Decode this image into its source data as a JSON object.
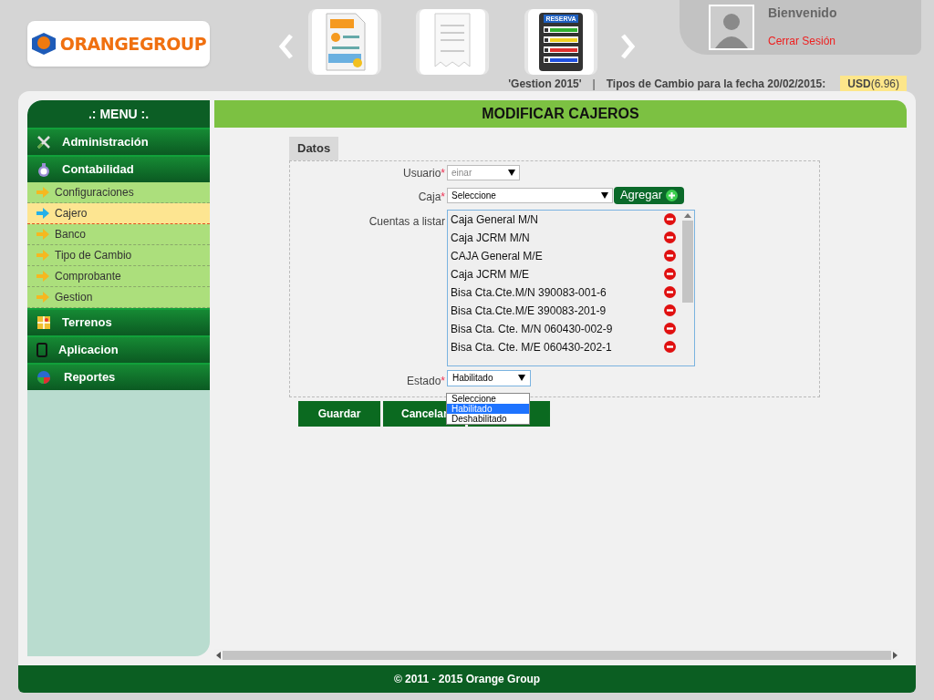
{
  "header": {
    "logo": "ORANGEGROUP",
    "carousel": [
      {
        "kind": "paycard"
      },
      {
        "kind": "receipt"
      },
      {
        "kind": "reserva",
        "label": "RESERVA"
      }
    ],
    "welcome": "Bienvenido",
    "logout": "Cerrar Sesión"
  },
  "info_bar": {
    "gestion": "'Gestion 2015'",
    "separator": "|",
    "exchange_label": "Tipos de Cambio para la fecha 20/02/2015:",
    "currency": "USD",
    "rate": "(6.96)"
  },
  "menu": {
    "title": ".: MENU :.",
    "items": [
      {
        "label": "Administración"
      },
      {
        "label": "Contabilidad",
        "children": [
          {
            "label": "Configuraciones",
            "selected": false
          },
          {
            "label": "Cajero",
            "selected": true
          },
          {
            "label": "Banco",
            "selected": false
          },
          {
            "label": "Tipo de Cambio",
            "selected": false
          },
          {
            "label": "Comprobante",
            "selected": false
          },
          {
            "label": "Gestion",
            "selected": false
          }
        ]
      },
      {
        "label": "Terrenos"
      },
      {
        "label": "Aplicacion"
      },
      {
        "label": "Reportes"
      }
    ]
  },
  "page_title": "MODIFICAR CAJEROS",
  "form": {
    "tab": "Datos",
    "usuario": {
      "label": "Usuario",
      "required": "*",
      "value": "einar",
      "disabled": true
    },
    "caja": {
      "label": "Caja",
      "required": "*",
      "value": "Seleccione",
      "add_button": "Agregar"
    },
    "cuentas": {
      "label": "Cuentas a listar",
      "items": [
        "Caja General M/N",
        "Caja JCRM M/N",
        "CAJA General M/E",
        "Caja JCRM M/E",
        "Bisa Cta.Cte.M/N 390083-001-6",
        "Bisa Cta.Cte.M/E 390083-201-9",
        "Bisa Cta. Cte. M/N 060430-002-9",
        "Bisa Cta. Cte. M/E 060430-202-1"
      ]
    },
    "estado": {
      "label": "Estado",
      "required": "*",
      "value": "Habilitado",
      "options": [
        {
          "label": "Seleccione",
          "selected": false
        },
        {
          "label": "Habilitado",
          "selected": true
        },
        {
          "label": "Deshabilitado",
          "selected": false
        }
      ]
    }
  },
  "buttons": [
    "Guardar",
    "Cancelar"
  ],
  "footer": "© 2011 - 2015 Orange Group"
}
